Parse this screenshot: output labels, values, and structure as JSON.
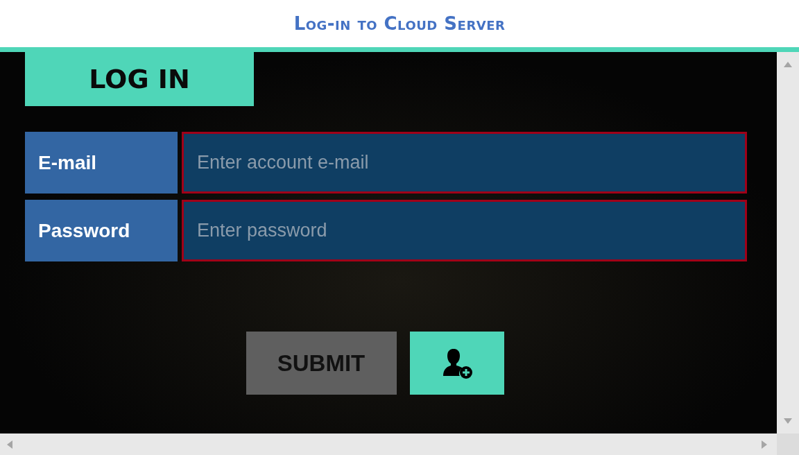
{
  "title": "Log-in to Cloud Server",
  "tab": {
    "label": "LOG IN"
  },
  "fields": [
    {
      "label": "E-mail",
      "placeholder": "Enter account e-mail",
      "invalid": true
    },
    {
      "label": "Password",
      "placeholder": "Enter password",
      "invalid": true
    }
  ],
  "submit": {
    "label": "SUBMIT",
    "disabled": true
  }
}
